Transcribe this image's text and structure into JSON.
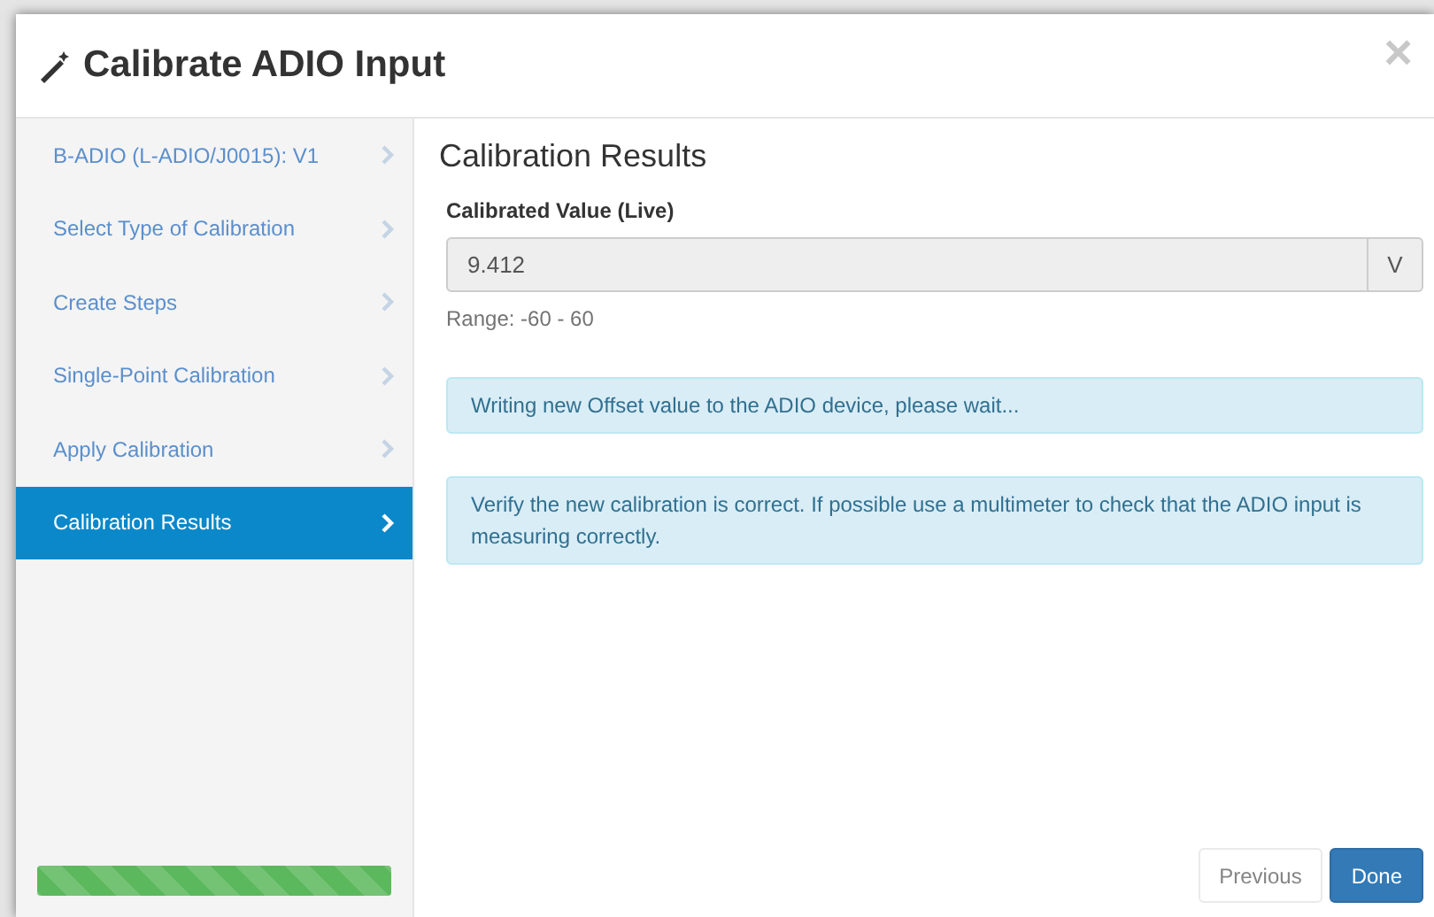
{
  "dialog": {
    "title": "Calibrate ADIO Input",
    "close": "×"
  },
  "steps": [
    {
      "label": "B-ADIO (L-ADIO/J0015): V1",
      "selected": false
    },
    {
      "label": "Select Type of Calibration",
      "selected": false
    },
    {
      "label": "Create Steps",
      "selected": false
    },
    {
      "label": "Single-Point Calibration",
      "selected": false
    },
    {
      "label": "Apply Calibration",
      "selected": false
    },
    {
      "label": "Calibration Results",
      "selected": true
    }
  ],
  "progress": {
    "level": 1
  },
  "content": {
    "heading": "Calibration Results",
    "field": {
      "label": "Calibrated Value (Live)",
      "value": "9.412",
      "unit": "V",
      "disabled": true
    },
    "range": "Range: -60 - 60",
    "alerts": [
      "Writing new Offset value to the ADIO device, please wait...",
      "Verify the new calibration is correct. If possible use a multimeter to check that the ADIO input is measuring correctly."
    ]
  },
  "buttons": [
    {
      "label": "Previous",
      "kind": "default",
      "disabled": true
    },
    {
      "label": "Done",
      "kind": "primary",
      "disabled": false
    }
  ]
}
